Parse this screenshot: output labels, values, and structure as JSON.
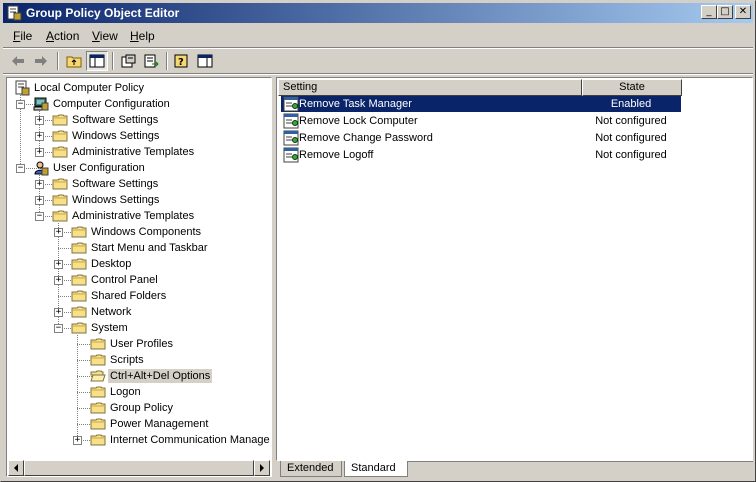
{
  "window": {
    "title": "Group Policy Object Editor",
    "buttons": {
      "minimize": "_",
      "maximize": "□",
      "close": "✕"
    }
  },
  "menu": [
    {
      "label": "File",
      "accel": "F"
    },
    {
      "label": "Action",
      "accel": "A"
    },
    {
      "label": "View",
      "accel": "V"
    },
    {
      "label": "Help",
      "accel": "H"
    }
  ],
  "toolbar": [
    "back-arrow-icon",
    "forward-arrow-icon",
    "up-folder-icon",
    "show-hide-tree-icon",
    "properties-icon",
    "export-list-icon",
    "help-icon",
    "show-hide-action-pane-icon"
  ],
  "tree": [
    {
      "label": "Local Computer Policy",
      "icon": "policy-icon",
      "depth": 0,
      "expander": ""
    },
    {
      "label": "Computer Configuration",
      "icon": "computer-icon",
      "depth": 1,
      "expander": "−"
    },
    {
      "label": "Software Settings",
      "icon": "folder-icon",
      "depth": 2,
      "expander": "+"
    },
    {
      "label": "Windows Settings",
      "icon": "folder-icon",
      "depth": 2,
      "expander": "+"
    },
    {
      "label": "Administrative Templates",
      "icon": "folder-icon",
      "depth": 2,
      "expander": "+"
    },
    {
      "label": "User Configuration",
      "icon": "user-icon",
      "depth": 1,
      "expander": "−"
    },
    {
      "label": "Software Settings",
      "icon": "folder-icon",
      "depth": 2,
      "expander": "+"
    },
    {
      "label": "Windows Settings",
      "icon": "folder-icon",
      "depth": 2,
      "expander": "+"
    },
    {
      "label": "Administrative Templates",
      "icon": "folder-icon",
      "depth": 2,
      "expander": "−"
    },
    {
      "label": "Windows Components",
      "icon": "folder-icon",
      "depth": 3,
      "expander": "+"
    },
    {
      "label": "Start Menu and Taskbar",
      "icon": "folder-icon",
      "depth": 3,
      "expander": ""
    },
    {
      "label": "Desktop",
      "icon": "folder-icon",
      "depth": 3,
      "expander": "+"
    },
    {
      "label": "Control Panel",
      "icon": "folder-icon",
      "depth": 3,
      "expander": "+"
    },
    {
      "label": "Shared Folders",
      "icon": "folder-icon",
      "depth": 3,
      "expander": ""
    },
    {
      "label": "Network",
      "icon": "folder-icon",
      "depth": 3,
      "expander": "+"
    },
    {
      "label": "System",
      "icon": "folder-icon",
      "depth": 3,
      "expander": "−"
    },
    {
      "label": "User Profiles",
      "icon": "folder-icon",
      "depth": 4,
      "expander": ""
    },
    {
      "label": "Scripts",
      "icon": "folder-icon",
      "depth": 4,
      "expander": ""
    },
    {
      "label": "Ctrl+Alt+Del Options",
      "icon": "open-folder-icon",
      "depth": 4,
      "expander": "",
      "selected": true
    },
    {
      "label": "Logon",
      "icon": "folder-icon",
      "depth": 4,
      "expander": ""
    },
    {
      "label": "Group Policy",
      "icon": "folder-icon",
      "depth": 4,
      "expander": ""
    },
    {
      "label": "Power Management",
      "icon": "folder-icon",
      "depth": 4,
      "expander": ""
    },
    {
      "label": "Internet Communication Managem",
      "icon": "folder-icon",
      "depth": 4,
      "expander": "+"
    }
  ],
  "list": {
    "columns": {
      "setting": "Setting",
      "state": "State"
    },
    "rows": [
      {
        "setting": "Remove Task Manager",
        "state": "Enabled",
        "selected": true
      },
      {
        "setting": "Remove Lock Computer",
        "state": "Not configured"
      },
      {
        "setting": "Remove Change Password",
        "state": "Not configured"
      },
      {
        "setting": "Remove Logoff",
        "state": "Not configured"
      }
    ]
  },
  "tabs": [
    {
      "label": "Extended",
      "active": false
    },
    {
      "label": "Standard",
      "active": true
    }
  ],
  "scrollbar": {
    "left": "◀",
    "right": "▶"
  }
}
